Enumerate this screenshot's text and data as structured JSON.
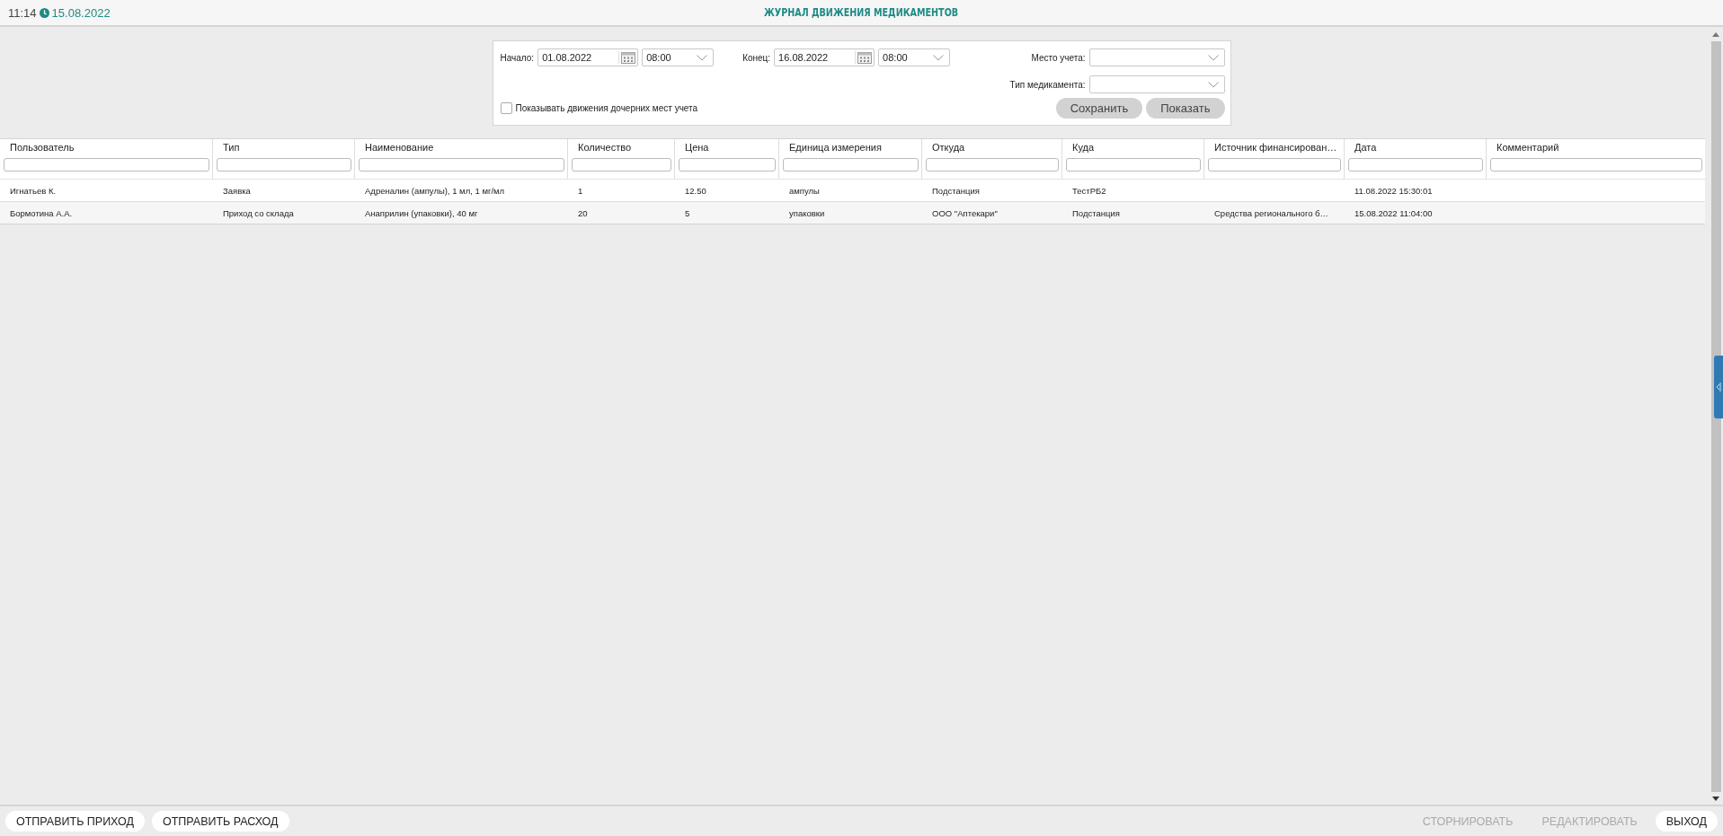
{
  "header": {
    "time": "11:14",
    "date": "15.08.2022",
    "title": "ЖУРНАЛ ДВИЖЕНИЯ МЕДИКАМЕНТОВ"
  },
  "filters": {
    "start": {
      "label": "Начало:",
      "date": "01.08.2022",
      "time": "08:00"
    },
    "end": {
      "label": "Конец:",
      "date": "16.08.2022",
      "time": "08:00"
    },
    "place": {
      "label": "Место учета:"
    },
    "med_type": {
      "label": "Тип медикамента:"
    },
    "child_places": {
      "label": "Показывать движения дочерних мест учета",
      "checked": false
    },
    "buttons": [
      "Сохранить",
      "Показать"
    ]
  },
  "table": {
    "columns": [
      "Пользователь",
      "Тип",
      "Наименование",
      "Количество",
      "Цена",
      "Единица измерения",
      "Откуда",
      "Куда",
      "Источник финансирован…",
      "Дата",
      "Комментарий"
    ],
    "rows": [
      [
        "Игнатьев К.",
        "Заявка",
        "Адреналин (ампулы), 1 мл, 1 мг/мл",
        "1",
        "12.50",
        "ампулы",
        "Подстанция",
        "ТестРБ2",
        "",
        "11.08.2022 15:30:01",
        ""
      ],
      [
        "Бормотина А.А.",
        "Приход со склада",
        "Анаприлин (упаковки), 40 мг",
        "20",
        "5",
        "упаковки",
        "ООО \"Аптекари\"",
        "Подстанция",
        "Средства регионального б…",
        "15.08.2022 11:04:00",
        ""
      ]
    ]
  },
  "footer": {
    "left": [
      {
        "label": "ОТПРАВИТЬ ПРИХОД",
        "disabled": false
      },
      {
        "label": "ОТПРАВИТЬ РАСХОД",
        "disabled": false
      }
    ],
    "right": [
      {
        "label": "СТОРНИРОВАТЬ",
        "disabled": true
      },
      {
        "label": "РЕДАКТИРОВАТЬ",
        "disabled": true
      },
      {
        "label": "ВЫХОД",
        "disabled": false
      }
    ]
  }
}
